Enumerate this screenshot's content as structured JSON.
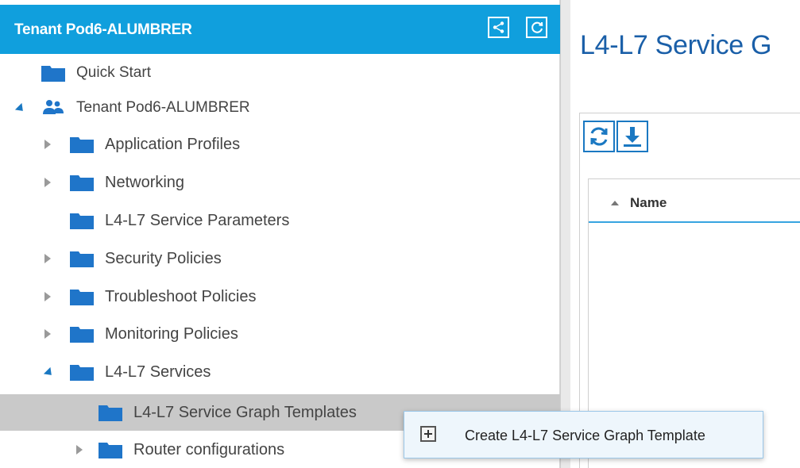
{
  "left_pane": {
    "header_title": "Tenant Pod6-ALUMBRER",
    "tree": [
      {
        "label": "Quick Start",
        "expand": "none"
      },
      {
        "label": "Tenant Pod6-ALUMBRER",
        "expand": "open"
      },
      {
        "label": "Application Profiles",
        "expand": "closed"
      },
      {
        "label": "Networking",
        "expand": "closed"
      },
      {
        "label": "L4-L7 Service Parameters",
        "expand": "none"
      },
      {
        "label": "Security Policies",
        "expand": "closed"
      },
      {
        "label": "Troubleshoot Policies",
        "expand": "closed"
      },
      {
        "label": "Monitoring Policies",
        "expand": "closed"
      },
      {
        "label": "L4-L7 Services",
        "expand": "open"
      },
      {
        "label": "L4-L7 Service Graph Templates",
        "expand": "none",
        "selected": true
      },
      {
        "label": "Router configurations",
        "expand": "closed"
      }
    ]
  },
  "main": {
    "title": "L4-L7 Service G",
    "grid": {
      "column_name": "Name"
    }
  },
  "context_menu": {
    "items": [
      {
        "label": "Create L4-L7 Service Graph Template",
        "icon": "plus-box-icon"
      }
    ]
  },
  "colors": {
    "header_bg": "#109fdd",
    "folder": "#1f75c9",
    "title": "#1a5fa8",
    "selected_row": "#c9c9c9"
  }
}
